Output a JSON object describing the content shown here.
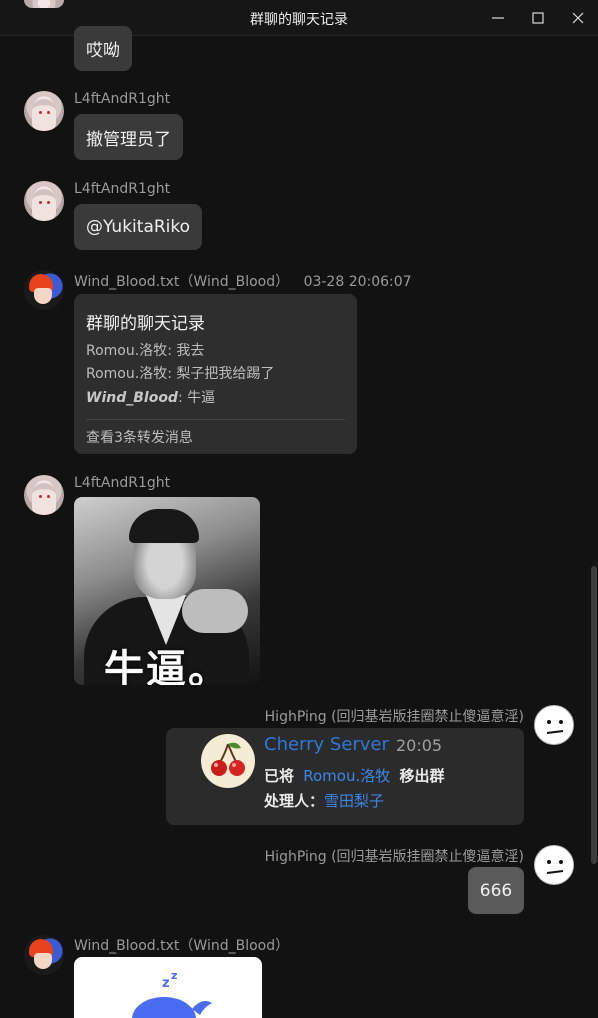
{
  "window": {
    "title": "群聊的聊天记录",
    "controls": [
      "minimize-icon",
      "maximize-icon",
      "close-icon"
    ]
  },
  "messages": [
    {
      "sender": "",
      "avatar": "avatar-girl",
      "text": "哎呦"
    },
    {
      "sender": "L4ftAndR1ght",
      "avatar": "avatar-girl",
      "text": "撤管理员了"
    },
    {
      "sender": "L4ftAndR1ght",
      "avatar": "avatar-girl",
      "text": "@YukitaRiko"
    },
    {
      "sender": "Wind_Blood.txt（Wind_Blood）",
      "time": "03-28 20:06:07",
      "avatar": "avatar-wind",
      "forward": {
        "title": "群聊的聊天记录",
        "lines": [
          {
            "who": "Romou.洛牧:",
            "text": " 我去"
          },
          {
            "who": "Romou.洛牧:",
            "text": " 梨子把我给踢了"
          },
          {
            "who": "Wind_Blood",
            "text": ": 牛逼"
          }
        ],
        "footer": "查看3条转发消息"
      }
    },
    {
      "sender": "L4ftAndR1ght",
      "avatar": "avatar-girl",
      "image_caption": "牛逼。"
    },
    {
      "sender": "HighPing (回归基岩版挂圈禁止傻逼意淫)",
      "avatar": "avatar-highping",
      "card": {
        "bot_name": "Cherry Server",
        "time": "20:05",
        "line1_prefix": "已将",
        "line1_user": "Romou.洛牧",
        "line1_suffix": "移出群",
        "line2_prefix": "处理人：",
        "line2_user": "雪田梨子",
        "logo_text": "Cherry Server"
      }
    },
    {
      "sender": "HighPing (回归基岩版挂圈禁止傻逼意淫)",
      "avatar": "avatar-highping",
      "text": "666"
    },
    {
      "sender": "Wind_Blood.txt（Wind_Blood）",
      "avatar": "avatar-wind",
      "sticker": "sleeping-whale-sticker"
    }
  ],
  "colors": {
    "background": "#121212",
    "bubble": "#3a3a3a",
    "self_bubble": "#5a5a5a",
    "link": "#3a86e8",
    "name": "#9a9a9a"
  }
}
